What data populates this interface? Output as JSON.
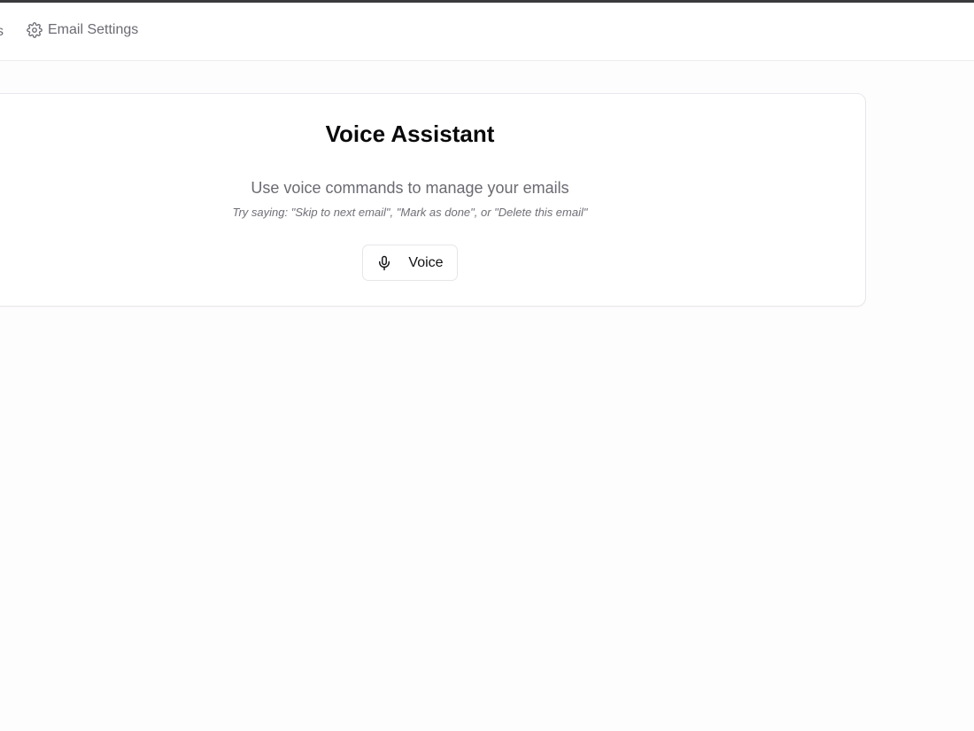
{
  "nav": {
    "cut_item_label": "s",
    "email_settings_label": "Email Settings",
    "settings_icon": "gear-icon"
  },
  "card": {
    "title": "Voice Assistant",
    "subtitle": "Use voice commands to manage your emails",
    "hint": "Try saying: \"Skip to next email\", \"Mark as done\", or \"Delete this email\"",
    "voice_button_label": "Voice",
    "voice_icon": "microphone-icon"
  },
  "colors": {
    "text_primary": "#0a0a0c",
    "text_muted": "#6b6b73",
    "border": "#e8e8ec",
    "top_border": "#3a3a3c"
  }
}
